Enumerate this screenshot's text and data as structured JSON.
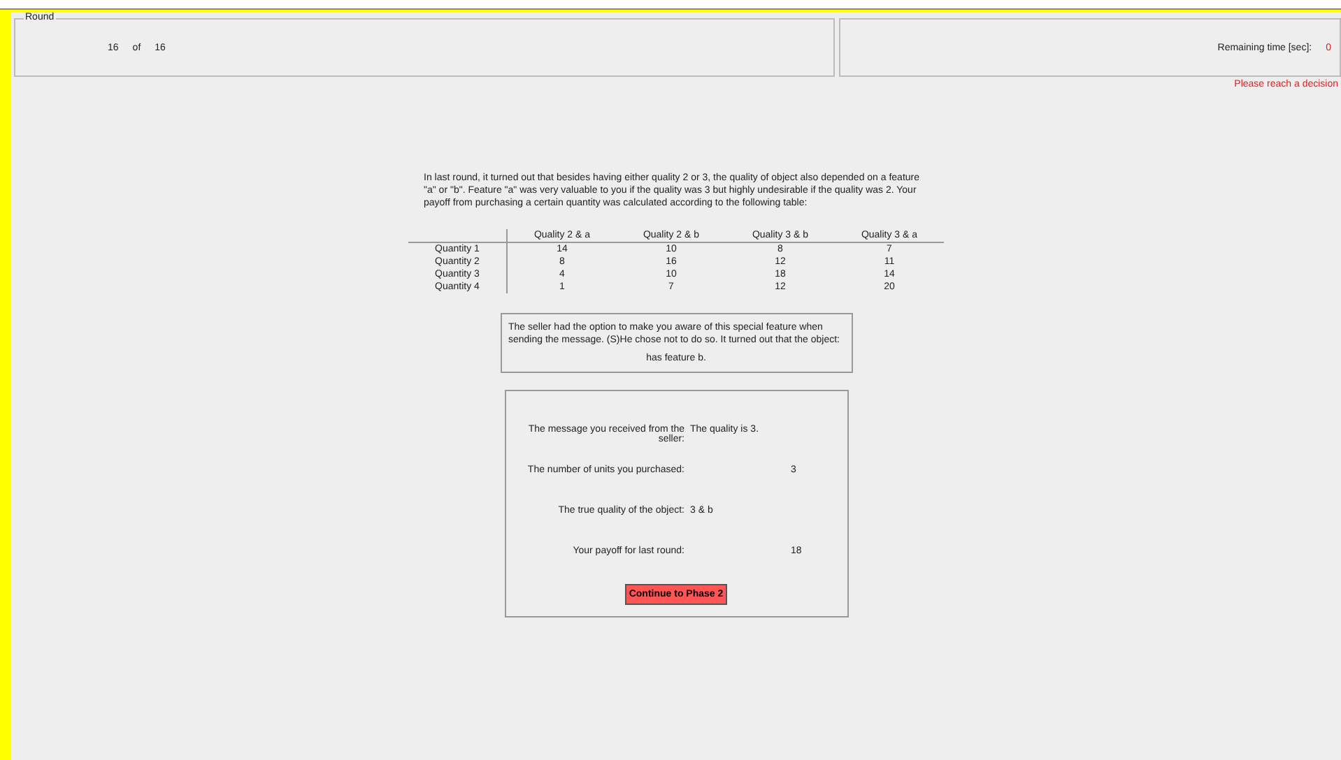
{
  "round_panel": {
    "title": "Round",
    "current": "16",
    "of_label": "of",
    "total": "16"
  },
  "timer_panel": {
    "label": "Remaining time [sec]:",
    "value": "0"
  },
  "warning": "Please reach a decision",
  "intro": "In last round, it turned out that besides having either quality 2 or 3, the quality of object also depended on a feature \"a\" or \"b\". Feature \"a\" was very valuable to you if the quality was 3 but highly undesirable if the quality was 2. Your payoff from purchasing a certain quantity was calculated according to the following table:",
  "table": {
    "columns": [
      "Quality 2 & a",
      "Quality 2 & b",
      "Quality 3 & b",
      "Quality 3 & a"
    ],
    "rows": [
      {
        "label": "Quantity 1",
        "cells": [
          "14",
          "10",
          "8",
          "7"
        ]
      },
      {
        "label": "Quantity 2",
        "cells": [
          "8",
          "16",
          "12",
          "11"
        ]
      },
      {
        "label": "Quantity 3",
        "cells": [
          "4",
          "10",
          "18",
          "14"
        ]
      },
      {
        "label": "Quantity 4",
        "cells": [
          "1",
          "7",
          "12",
          "20"
        ]
      }
    ]
  },
  "feature_box": {
    "text": "The seller had the option to make you aware of this special feature when sending the message. (S)He chose not to do so. It turned out that the object:",
    "result": "has feature b."
  },
  "results": [
    {
      "kind": "text",
      "label": "The message you received from the seller:",
      "value": "The quality is 3."
    },
    {
      "kind": "number",
      "label": "The number of units you purchased:",
      "value": "3"
    },
    {
      "kind": "text",
      "label": "The true quality of the object:",
      "value": "3 & b"
    },
    {
      "kind": "number",
      "label": "Your payoff for last round:",
      "value": "18"
    }
  ],
  "continue_button": "Continue to Phase 2"
}
